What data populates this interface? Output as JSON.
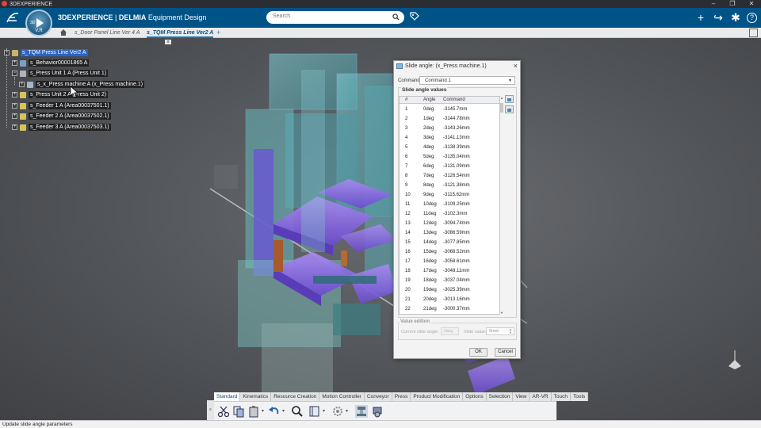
{
  "window": {
    "app_name": "3DEXPERIENCE"
  },
  "header": {
    "brand_bold": "3DEXPERIENCE",
    "brand_sep": " | ",
    "brand_company": "DELMIA",
    "brand_app": " Equipment Design",
    "compass_version": "V.R",
    "compass_3d": "3D",
    "search_placeholder": "Search"
  },
  "tabs": [
    {
      "label": "s_Door Panel Line Ver 4 A",
      "active": false
    },
    {
      "label": "s_TQM Press Line Ver2 A",
      "active": true
    }
  ],
  "tabs_add": "+",
  "tree": {
    "close_label": "x",
    "nodes": [
      {
        "label": "s_TQM Press Line Ver2 A",
        "expander": "−",
        "selected": true
      },
      {
        "label": "s_Behavior00001865 A",
        "expander": "+",
        "selected": false
      },
      {
        "label": "s_Press Unit 1 A (Press Unit 1)",
        "expander": "−",
        "selected": false
      },
      {
        "label": "s_x_Press machine A (x_Press machine.1)",
        "expander": "+",
        "selected": false
      },
      {
        "label": "s_Press Unit 2 A (Press Unit 2)",
        "expander": "+",
        "selected": false
      },
      {
        "label": "s_Feeder 1 A (Area00037501.1)",
        "expander": "+",
        "selected": false
      },
      {
        "label": "s_Feeder 2 A (Area00037502.1)",
        "expander": "+",
        "selected": false
      },
      {
        "label": "s_Feeder 3 A (Area00037503.1)",
        "expander": "+",
        "selected": false
      }
    ]
  },
  "dialog": {
    "title": "Slide angle: (x_Press machine.1)",
    "close": "×",
    "command_label": "Command:",
    "command_value": "Command 1",
    "group_title": "Slide angle values",
    "columns": [
      "#",
      "Angle",
      "Command"
    ],
    "rows": [
      [
        "1",
        "0deg",
        "-3145.7mm"
      ],
      [
        "2",
        "1deg",
        "-3144.78mm"
      ],
      [
        "3",
        "2deg",
        "-3143.26mm"
      ],
      [
        "4",
        "3deg",
        "-3141.13mm"
      ],
      [
        "5",
        "4deg",
        "-3138.39mm"
      ],
      [
        "6",
        "5deg",
        "-3135.04mm"
      ],
      [
        "7",
        "6deg",
        "-3131.09mm"
      ],
      [
        "8",
        "7deg",
        "-3126.54mm"
      ],
      [
        "9",
        "8deg",
        "-3121.38mm"
      ],
      [
        "10",
        "9deg",
        "-3115.62mm"
      ],
      [
        "11",
        "10deg",
        "-3109.25mm"
      ],
      [
        "12",
        "11deg",
        "-3102.3mm"
      ],
      [
        "13",
        "12deg",
        "-3094.74mm"
      ],
      [
        "14",
        "13deg",
        "-3086.59mm"
      ],
      [
        "15",
        "14deg",
        "-3077.85mm"
      ],
      [
        "16",
        "15deg",
        "-3068.52mm"
      ],
      [
        "17",
        "16deg",
        "-3058.61mm"
      ],
      [
        "18",
        "17deg",
        "-3048.11mm"
      ],
      [
        "19",
        "18deg",
        "-3037.04mm"
      ],
      [
        "20",
        "19deg",
        "-3025.39mm"
      ],
      [
        "21",
        "20deg",
        "-3013.16mm"
      ],
      [
        "22",
        "21deg",
        "-3000.37mm"
      ]
    ],
    "value_edition_title": "Value edition",
    "current_slide_angle_label": "Current slide angle:",
    "current_slide_angle_value": "0deg",
    "slide_value_label": "Slide value:",
    "slide_value": "0mm",
    "ok_label": "OK",
    "cancel_label": "Cancel"
  },
  "actionbar": {
    "tabs": [
      "Standard",
      "Kinematics",
      "Resource Creation",
      "Motion Controller",
      "Conveyor",
      "Press",
      "Product Modification",
      "Options",
      "Selection",
      "View",
      "AR-VR",
      "Touch",
      "Tools"
    ],
    "active_tab": "Standard",
    "tools": [
      "cut-icon",
      "copy-icon",
      "paste-icon",
      "undo-icon",
      "zoom-icon",
      "book-icon",
      "settings-icon",
      "press-machine-icon",
      "press-robot-icon"
    ]
  },
  "status": {
    "text": "Update slide angle parameters"
  },
  "colors": {
    "header": "#005386",
    "accent": "#0a78c2",
    "selection": "#2b63c7"
  }
}
